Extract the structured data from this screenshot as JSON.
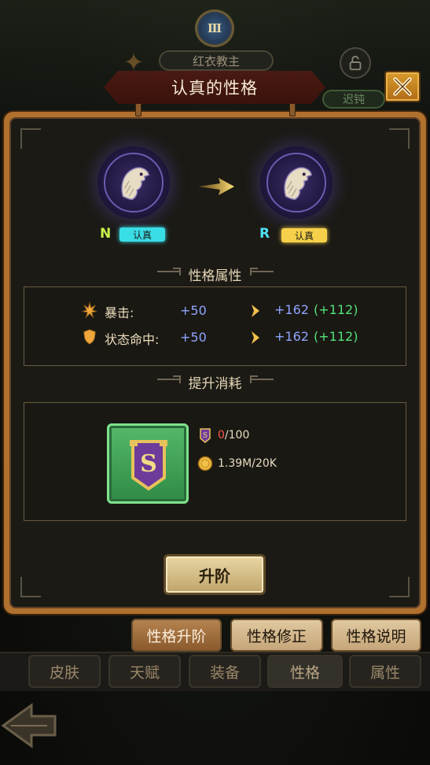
{
  "hero": {
    "rank_numeral": "Ⅲ",
    "name": "红衣教主",
    "dull_tag": "迟钝"
  },
  "dialog": {
    "title": "认真的性格"
  },
  "personality": {
    "from": {
      "rarity": "N",
      "tag": "认真",
      "rarity_color": "#c6f24a",
      "tag_color": "#39dde6"
    },
    "to": {
      "rarity": "R",
      "tag": "认真",
      "rarity_color": "#4ee0f2",
      "tag_color": "#f6d04a"
    },
    "emblem_icon": "eagle-icon"
  },
  "attributes_section": {
    "title": "性格属性",
    "rows": [
      {
        "name": "暴击:",
        "icon": "crit-icon",
        "base": "+50",
        "new": "+162",
        "delta": "(+112)"
      },
      {
        "name": "状态命中:",
        "icon": "shield-icon",
        "base": "+50",
        "new": "+162",
        "delta": "(+112)"
      }
    ]
  },
  "cost_section": {
    "title": "提升消耗",
    "item_icon": "personality-badge-icon",
    "costs": [
      {
        "icon": "badge-small-icon",
        "current": "0",
        "required": "/100"
      },
      {
        "icon": "gold-coin-icon",
        "current": "1.39M/20K",
        "required": ""
      }
    ]
  },
  "actions": {
    "upgrade_label": "升阶"
  },
  "subtabs": [
    "性格升阶",
    "性格修正",
    "性格说明"
  ],
  "bottom_tabs": [
    "皮肤",
    "天赋",
    "装备",
    "性格",
    "属性"
  ],
  "colors": {
    "panel_frame": "#b0702e",
    "panel_bg": "#1c1a15",
    "stat_blue": "#8fa4ff",
    "stat_green": "#52e27a",
    "insufficient_red": "#ff5a4a",
    "item_green": "#3f9a55"
  }
}
